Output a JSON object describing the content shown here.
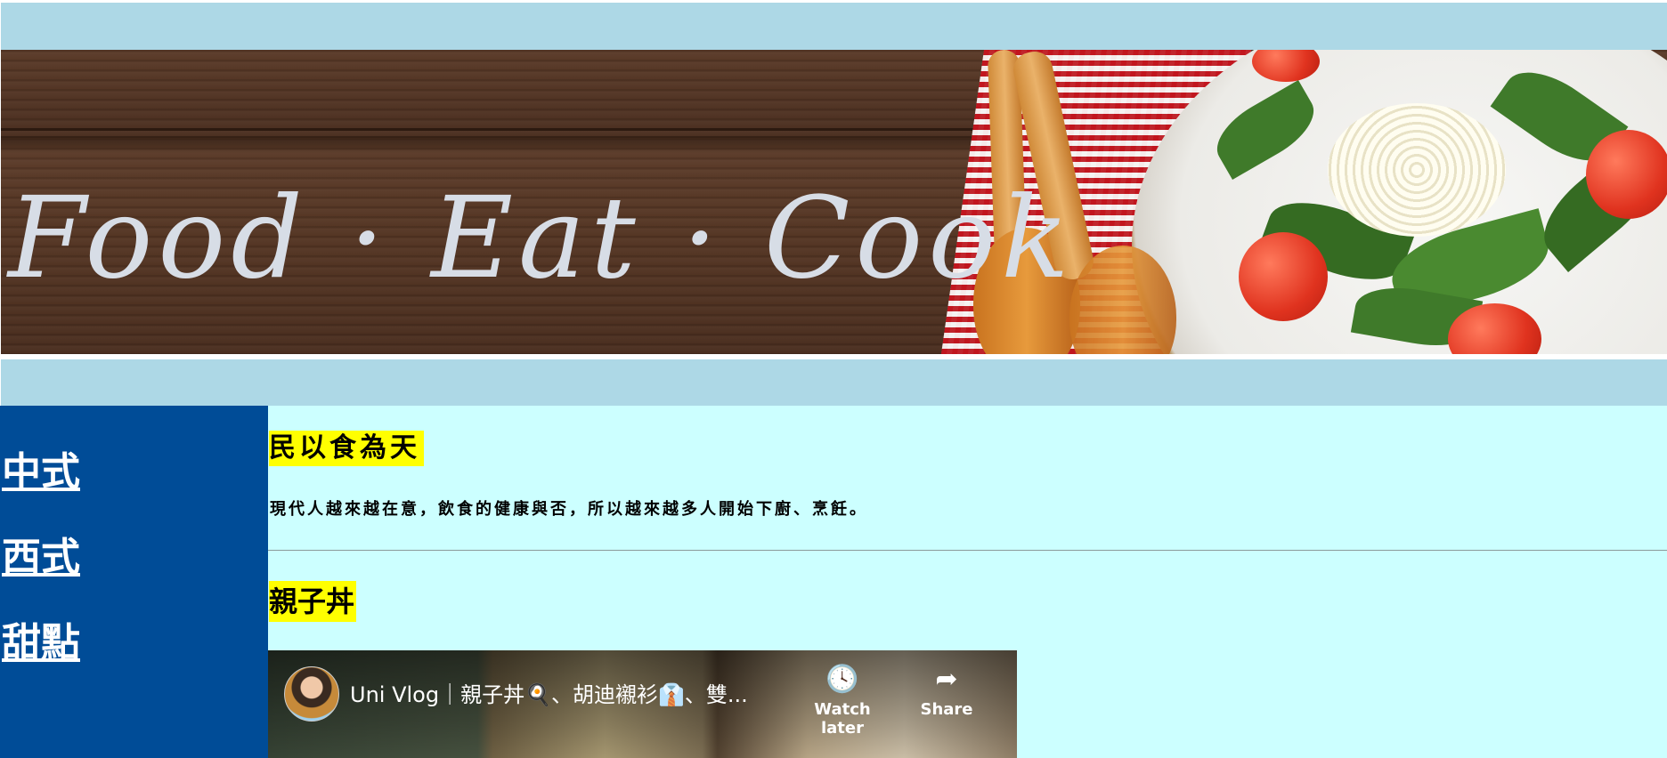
{
  "header": {
    "logo_text": "Food · Eat · Cook"
  },
  "sidebar": {
    "items": [
      {
        "label": "中式"
      },
      {
        "label": "西式"
      },
      {
        "label": "甜點"
      }
    ]
  },
  "main": {
    "heading": "民以食為天",
    "paragraph": "現代人越來越在意，飲食的健康與否，所以越來越多人開始下廚、烹飪。",
    "section_title": "親子丼",
    "video": {
      "title": "Uni Vlog｜親子丼🍳、胡迪襯衫👔、雙...",
      "watch_later_label": "Watch later",
      "share_label": "Share",
      "watch_later_icon": "clock-icon",
      "share_icon": "share-arrow-icon"
    }
  },
  "colors": {
    "bar_background": "#add8e6",
    "sidebar_background": "#004c97",
    "content_background": "#ccffff",
    "highlight": "#ffff00"
  }
}
